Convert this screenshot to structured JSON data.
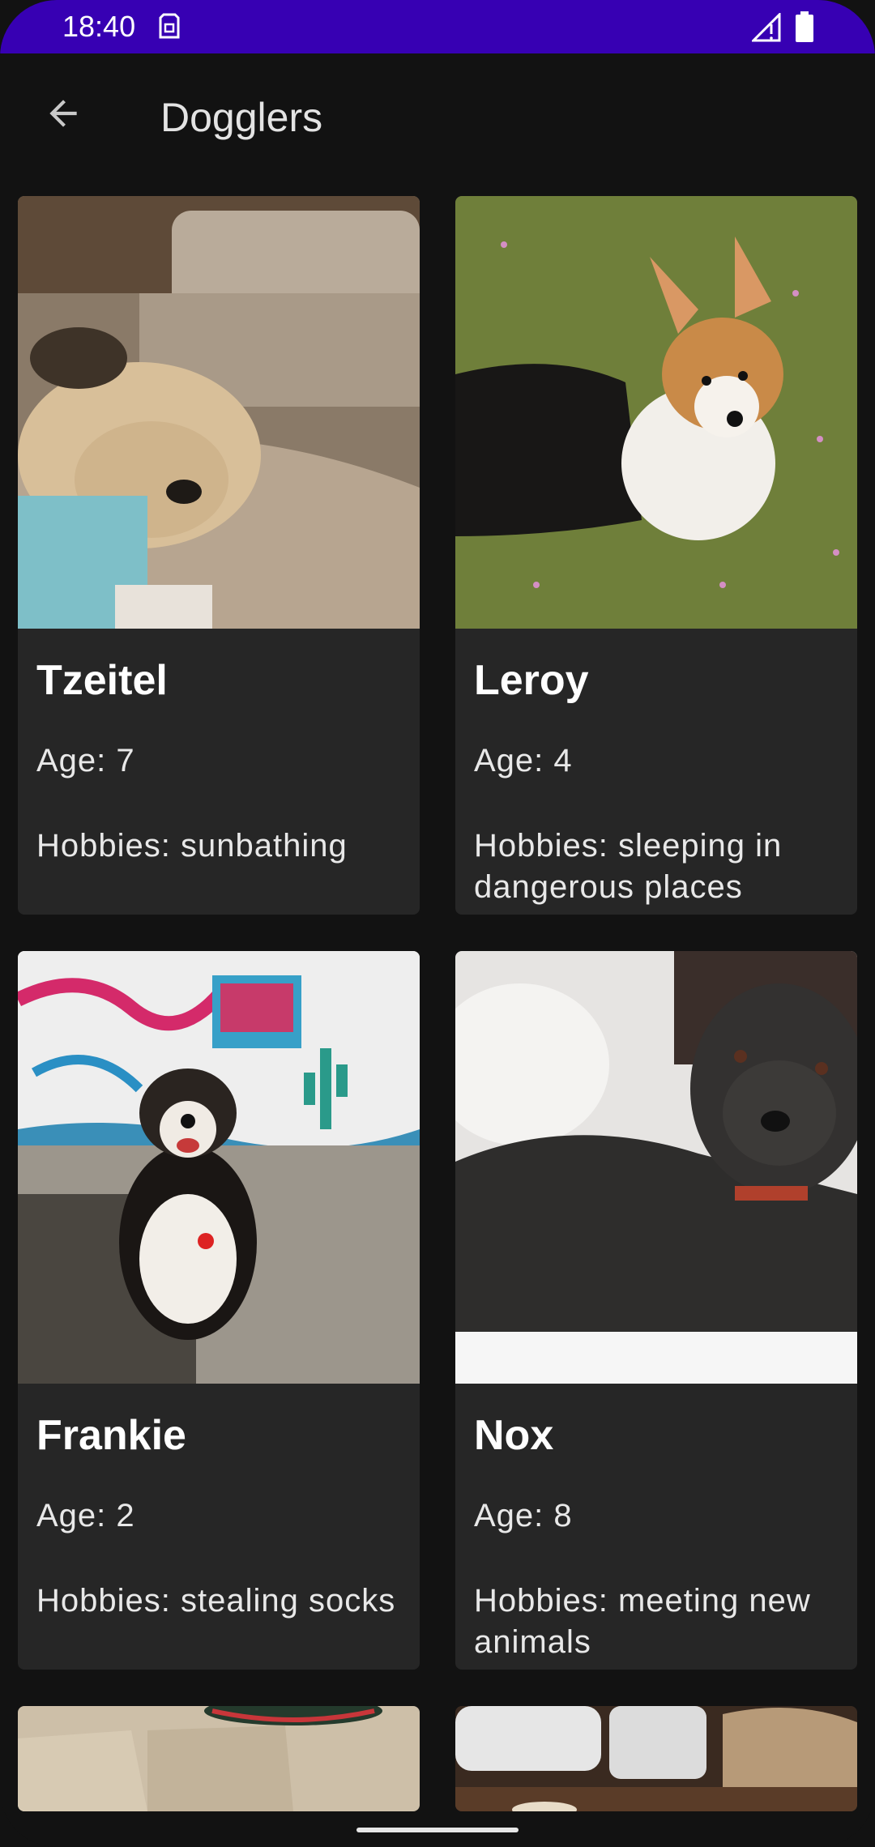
{
  "status_bar": {
    "time": "18:40",
    "icons": [
      "sim-icon",
      "signal-icon",
      "battery-icon"
    ],
    "background": "#3700b3"
  },
  "app_bar": {
    "title": "Dogglers",
    "back_icon": "arrow-back-icon"
  },
  "dogs": [
    {
      "name": "Tzeitel",
      "age": "Age: 7",
      "hobbies": "Hobbies: sunbathing"
    },
    {
      "name": "Leroy",
      "age": "Age: 4",
      "hobbies": "Hobbies: sleeping in dangerous places"
    },
    {
      "name": "Frankie",
      "age": "Age: 2",
      "hobbies": "Hobbies: stealing socks"
    },
    {
      "name": "Nox",
      "age": "Age: 8",
      "hobbies": "Hobbies: meeting new animals"
    }
  ],
  "colors": {
    "background": "#121212",
    "card": "#262626",
    "text_primary": "#ffffff",
    "text_secondary": "#e8e8e8"
  }
}
